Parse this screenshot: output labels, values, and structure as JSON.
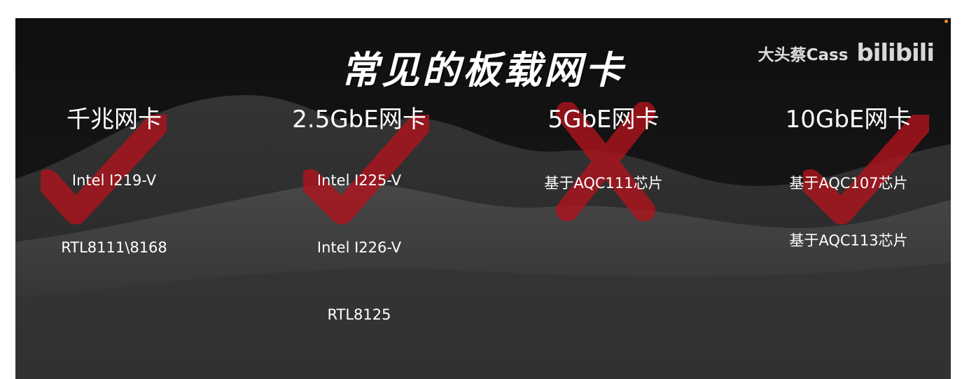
{
  "slide": {
    "title": "常见的板载网卡",
    "author": "大头蔡Cass",
    "platform_logo": "bilibili"
  },
  "columns": [
    {
      "heading": "千兆网卡",
      "mark": "check",
      "items": [
        "Intel I219-V",
        "RTL8111\\8168"
      ]
    },
    {
      "heading": "2.5GbE网卡",
      "mark": "check",
      "items": [
        "Intel I225-V",
        "Intel I226-V",
        "RTL8125"
      ]
    },
    {
      "heading": "5GbE网卡",
      "mark": "cross",
      "items": [
        "基于AQC111芯片"
      ]
    },
    {
      "heading": "10GbE网卡",
      "mark": "check",
      "items": [
        "基于AQC107芯片",
        "基于AQC113芯片"
      ]
    }
  ],
  "colors": {
    "background": "#141414",
    "mark_red": "#b3121c",
    "text": "#ffffff",
    "accent_dot": "#f08c2a"
  },
  "icons": {
    "check": "check-mark-icon",
    "cross": "cross-mark-icon"
  }
}
